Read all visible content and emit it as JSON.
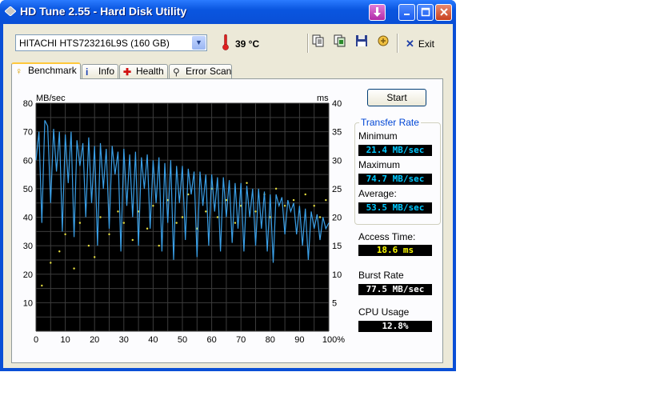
{
  "window": {
    "title": "HD Tune 2.55 - Hard Disk Utility"
  },
  "toolbar": {
    "drive": "HITACHI HTS723216L9S (160 GB)",
    "temperature": "39 °C",
    "exit_label": "Exit"
  },
  "tabs": [
    {
      "label": "Benchmark",
      "icon": "benchmark-icon",
      "active": true
    },
    {
      "label": "Info",
      "icon": "info-icon"
    },
    {
      "label": "Health",
      "icon": "health-cross-icon"
    },
    {
      "label": "Error Scan",
      "icon": "magnifier-icon"
    }
  ],
  "panel": {
    "start_label": "Start",
    "transfer_rate_title": "Transfer Rate",
    "minimum_label": "Minimum",
    "minimum_value": "21.4 MB/sec",
    "maximum_label": "Maximum",
    "maximum_value": "74.7 MB/sec",
    "average_label": "Average:",
    "average_value": "53.5 MB/sec",
    "access_time_label": "Access Time:",
    "access_time_value": "18.6 ms",
    "burst_rate_label": "Burst Rate",
    "burst_rate_value": "77.5 MB/sec",
    "cpu_usage_label": "CPU Usage",
    "cpu_usage_value": "12.8%"
  },
  "chart_data": {
    "type": "line",
    "ylabel": "MB/sec",
    "y2label": "ms",
    "ylim": [
      0,
      80
    ],
    "y2lim": [
      0,
      40
    ],
    "xlim": [
      0,
      100
    ],
    "x_ticks": [
      "0",
      "10",
      "20",
      "30",
      "40",
      "50",
      "60",
      "70",
      "80",
      "90",
      "100%"
    ],
    "y_ticks": [
      "10",
      "20",
      "30",
      "40",
      "50",
      "60",
      "70",
      "80"
    ],
    "y2_ticks": [
      "5",
      "10",
      "15",
      "20",
      "25",
      "30",
      "35",
      "40"
    ],
    "grid": true,
    "colors": {
      "background": "#000000",
      "grid": "#3c3c3c",
      "transfer": "#3aa0e8",
      "access": "#e8e040"
    },
    "series": [
      {
        "kind": "transfer-rate",
        "x": [
          0,
          1,
          2,
          3,
          4,
          5,
          6,
          7,
          8,
          9,
          10,
          11,
          12,
          13,
          14,
          15,
          16,
          17,
          18,
          19,
          20,
          21,
          22,
          23,
          24,
          25,
          26,
          27,
          28,
          29,
          30,
          31,
          32,
          33,
          34,
          35,
          36,
          37,
          38,
          39,
          40,
          41,
          42,
          43,
          44,
          45,
          46,
          47,
          48,
          49,
          50,
          51,
          52,
          53,
          54,
          55,
          56,
          57,
          58,
          59,
          60,
          61,
          62,
          63,
          64,
          65,
          66,
          67,
          68,
          69,
          70,
          71,
          72,
          73,
          74,
          75,
          76,
          77,
          78,
          79,
          80,
          81,
          82,
          83,
          84,
          85,
          86,
          87,
          88,
          89,
          90,
          91,
          92,
          93,
          94,
          95,
          96,
          97,
          98,
          99,
          100
        ],
        "values": [
          60,
          70,
          38,
          74,
          72,
          45,
          71,
          56,
          70,
          35,
          69,
          52,
          70,
          33,
          67,
          58,
          66,
          40,
          68,
          45,
          65,
          30,
          66,
          50,
          64,
          36,
          65,
          55,
          63,
          28,
          64,
          44,
          62,
          40,
          63,
          30,
          61,
          50,
          62,
          36,
          60,
          45,
          61,
          28,
          59,
          38,
          60,
          25,
          58,
          45,
          58,
          32,
          57,
          48,
          56,
          26,
          56,
          44,
          55,
          30,
          55,
          42,
          54,
          28,
          54,
          40,
          53,
          31,
          52,
          36,
          52,
          28,
          51,
          40,
          50,
          30,
          50,
          36,
          49,
          28,
          48,
          24,
          48,
          44,
          47,
          34,
          46,
          42,
          45,
          34,
          44,
          30,
          43,
          25,
          42,
          36,
          41,
          32,
          40,
          36,
          38
        ]
      }
    ],
    "access_time_ms": [
      [
        2,
        8
      ],
      [
        5,
        12
      ],
      [
        8,
        14
      ],
      [
        10,
        17
      ],
      [
        13,
        11
      ],
      [
        15,
        19
      ],
      [
        18,
        15
      ],
      [
        20,
        13
      ],
      [
        22,
        20
      ],
      [
        25,
        17
      ],
      [
        28,
        21
      ],
      [
        30,
        19
      ],
      [
        33,
        16
      ],
      [
        35,
        21
      ],
      [
        38,
        18
      ],
      [
        40,
        22
      ],
      [
        42,
        15
      ],
      [
        45,
        23
      ],
      [
        48,
        19
      ],
      [
        50,
        20
      ],
      [
        52,
        24
      ],
      [
        55,
        18
      ],
      [
        58,
        21
      ],
      [
        60,
        25
      ],
      [
        62,
        20
      ],
      [
        65,
        23
      ],
      [
        68,
        19
      ],
      [
        70,
        22
      ],
      [
        72,
        26
      ],
      [
        75,
        21
      ],
      [
        78,
        24
      ],
      [
        80,
        20
      ],
      [
        82,
        25
      ],
      [
        85,
        22
      ],
      [
        88,
        23
      ],
      [
        90,
        21
      ],
      [
        92,
        24
      ],
      [
        95,
        22
      ],
      [
        97,
        20
      ],
      [
        99,
        23
      ]
    ]
  }
}
